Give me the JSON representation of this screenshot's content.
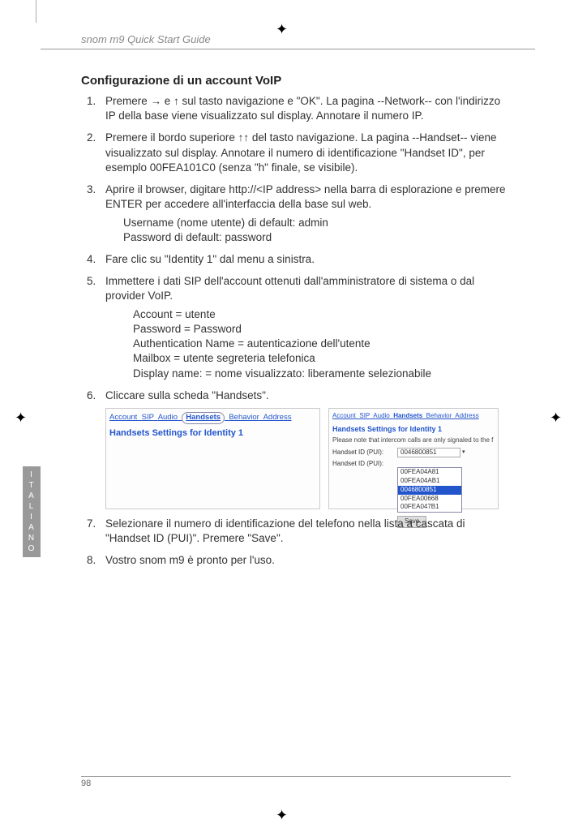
{
  "header": {
    "title": "snom m9 Quick Start Guide"
  },
  "side_tab": [
    "I",
    "T",
    "A",
    "L",
    "I",
    "A",
    "N",
    "O"
  ],
  "heading": "Configurazione di un account VoIP",
  "steps": {
    "s1": "Premere → e ↑  sul tasto navigazione e \"OK\". La pagina --Network-- con l'indirizzo IP della base viene visualizzato sul display. Annotare il numero IP.",
    "s2": "Premere il bordo superiore ↑↑ del tasto navigazione. La pagina --Handset-- viene visualizzato sul display. Annotare il numero di identificazione \"Handset ID\", per esemplo 00FEA101C0 (senza \"h\" finale, se visibile).",
    "s3": "Aprire il browser, digitare http://<IP address> nella barra di esplorazione e premere ENTER per accedere all'interfaccia della base sul web.",
    "s3a": "Username (nome utente) di default:  admin",
    "s3b": "Password di default:   password",
    "s4": "Fare clic su \"Identity 1\" dal menu a sinistra.",
    "s5": "Immettere i dati SIP dell'account ottenuti dall'amministratore di sistema o dal provider VoIP.",
    "s5a": "Account = utente",
    "s5b": "Password = Password",
    "s5c": "Authentication Name = autenticazione dell'utente",
    "s5d": "Mailbox = utente segreteria telefonica",
    "s5e": "Display name: = nome visualizzato: liberamente selezionabile",
    "s6": "Cliccare sulla scheda \"Handsets\".",
    "s7": "Selezionare il numero di identificazione del telefono nella lista a cascata di \"Handset ID (PUI)\".  Premere \"Save\".",
    "s8": "Vostro snom m9 è pronto per l'uso."
  },
  "screenshot": {
    "tabs": {
      "t1": "Account",
      "t2": "SIP",
      "t3": "Audio",
      "t4": "Handsets",
      "t5": "Behavior",
      "t6": "Address"
    },
    "title": "Handsets Settings for Identity 1",
    "note": "Please note that intercom calls are only signaled to the f",
    "field_label": "Handset ID (PUI):",
    "selected": "0046800851",
    "options": {
      "o1": "00FEA04A81",
      "o2": "00FEA04AB1",
      "o3": "0046800851",
      "o4": "00FEA00668",
      "o5": "00FEA047B1"
    },
    "save": "Save"
  },
  "page_number": "98"
}
